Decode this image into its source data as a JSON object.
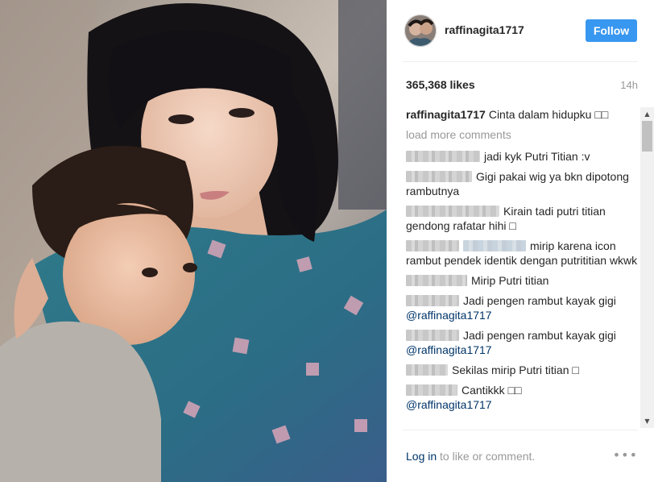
{
  "post": {
    "username": "raffinagita1717",
    "follow_label": "Follow",
    "likes": "365,368 likes",
    "time": "14h",
    "caption_author": "raffinagita1717",
    "caption_text": "Cinta dalam hidupku □□"
  },
  "comments_section": {
    "load_more": "load more comments",
    "items": [
      {
        "text": "jadi kyk Putri Titian :v"
      },
      {
        "text": "Gigi pakai wig ya bkn dipotong rambutnya"
      },
      {
        "text": "Kirain tadi putri titian gendong rafatar hihi □"
      },
      {
        "text": "mirip karena icon rambut pendek identik dengan putrititian wkwk"
      },
      {
        "text": "Mirip Putri titian"
      },
      {
        "text": "Jadi pengen rambut kayak gigi",
        "mention": "@raffinagita1717"
      },
      {
        "text": "Jadi pengen rambut kayak gigi",
        "mention": "@raffinagita1717"
      },
      {
        "text": "Sekilas mirip Putri titian □"
      },
      {
        "text": "Cantikkk □□",
        "mention": "@raffinagita1717"
      }
    ]
  },
  "footer": {
    "login_link": "Log in",
    "login_rest": " to like or comment.",
    "more_icon": "•••"
  },
  "scrollbar": {
    "up_arrow": "▲",
    "down_arrow": "▼"
  },
  "colors": {
    "accent": "#3897f0",
    "link": "#003569",
    "muted": "#999999"
  }
}
